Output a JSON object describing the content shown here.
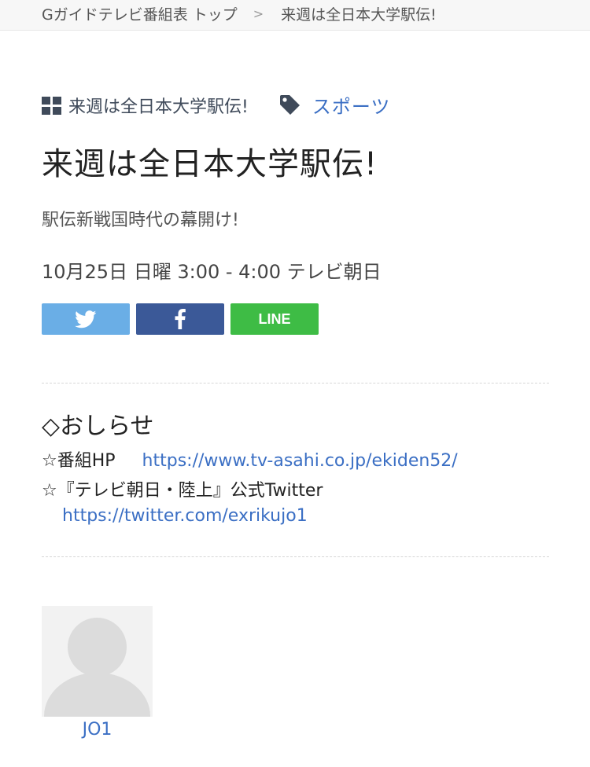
{
  "breadcrumb": {
    "home": "Gガイドテレビ番組表 トップ",
    "separator": ">",
    "current": "来週は全日本大学駅伝!"
  },
  "categories": {
    "series_label": "来週は全日本大学駅伝!",
    "genre_link": "スポーツ"
  },
  "program": {
    "title": "来週は全日本大学駅伝!",
    "subtitle": "駅伝新戦国時代の幕開け!",
    "schedule": "10月25日 日曜 3:00  - 4:00 テレビ朝日"
  },
  "share": {
    "twitter_icon": "twitter-icon",
    "facebook_icon": "facebook-icon",
    "line_label": "LINE",
    "colors": {
      "twitter": "#6aaee6",
      "facebook": "#3b5998",
      "line": "#3ebc45"
    }
  },
  "notice": {
    "heading": "◇おしらせ",
    "hp_label": "☆番組HP",
    "hp_url": "https://www.tv-asahi.co.jp/ekiden52/",
    "twitter_label": "☆『テレビ朝日・陸上』公式Twitter",
    "twitter_url": "https://twitter.com/exrikujo1"
  },
  "member": {
    "name": "JO1"
  },
  "colors": {
    "accent_link": "#3b6fc4",
    "icon_dark": "#3f4a5a"
  }
}
